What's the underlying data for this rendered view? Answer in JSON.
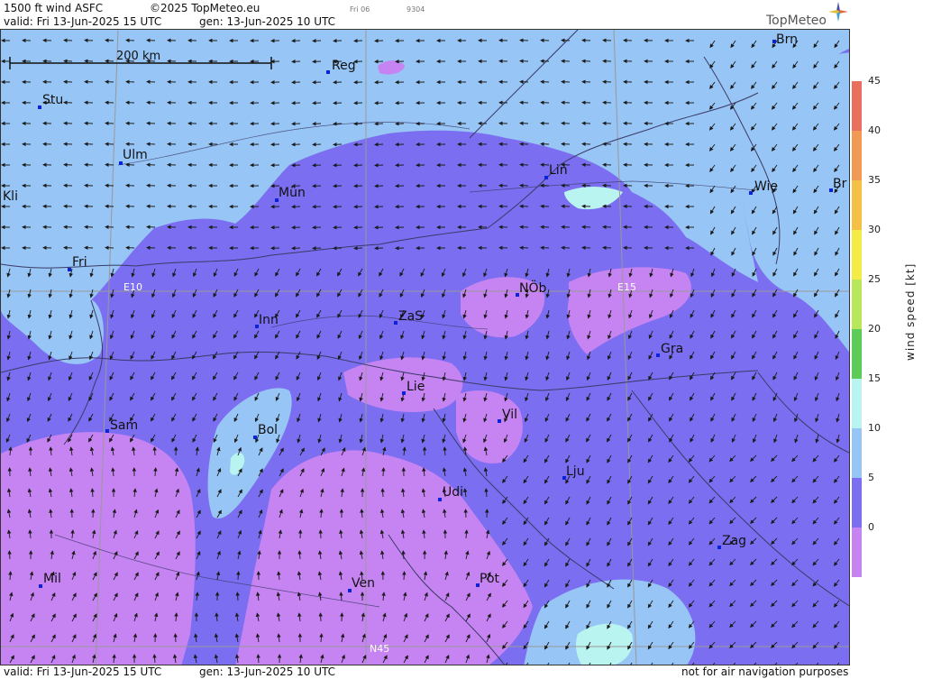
{
  "header": {
    "product": "1500 ft wind ASFC",
    "copyright": "©2025 TopMeteo.eu",
    "day_code": "Fri 06",
    "code": "9304",
    "valid": "valid:  Fri  13-Jun-2025  15 UTC",
    "generated": "gen: 13-Jun-2025 10 UTC",
    "logo_text": "TopMeteo"
  },
  "footer": {
    "valid": "valid:  Fri  13-Jun-2025  15 UTC",
    "generated": "gen: 13-Jun-2025 10 UTC",
    "disclaimer": "not for air navigation purposes"
  },
  "scale_bar": {
    "label": "200 km"
  },
  "grid_labels": {
    "lon_e10": "E10",
    "lon_e15": "E15",
    "lat_n45": "N45"
  },
  "cities": [
    {
      "name": "Brn"
    },
    {
      "name": "Reg"
    },
    {
      "name": "Stu"
    },
    {
      "name": "Ulm"
    },
    {
      "name": "Lin"
    },
    {
      "name": "Wie"
    },
    {
      "name": "Br"
    },
    {
      "name": "Mün"
    },
    {
      "name": "Kli"
    },
    {
      "name": "Fri"
    },
    {
      "name": "NÖb"
    },
    {
      "name": "Inn"
    },
    {
      "name": "ZaS"
    },
    {
      "name": "Gra"
    },
    {
      "name": "Lie"
    },
    {
      "name": "Sam"
    },
    {
      "name": "Bol"
    },
    {
      "name": "Vil"
    },
    {
      "name": "Lju"
    },
    {
      "name": "Udi"
    },
    {
      "name": "Zag"
    },
    {
      "name": "Mil"
    },
    {
      "name": "Ven"
    },
    {
      "name": "Pot"
    }
  ],
  "legend": {
    "title": "wind speed [kt]",
    "ticks": [
      "45",
      "40",
      "35",
      "30",
      "25",
      "20",
      "15",
      "10",
      "5",
      "0"
    ],
    "colors": [
      "#e96f5e",
      "#f19a55",
      "#f4c047",
      "#f4ec46",
      "#b8e85a",
      "#5ccb57",
      "#b9f4f0",
      "#97c5f5",
      "#7b6ef1",
      "#c683f2"
    ]
  },
  "map_colors": {
    "wind_0_5": "#c683f2",
    "wind_5_10": "#7b6ef1",
    "wind_10_15": "#97c5f5",
    "wind_15_20": "#b9f4f0",
    "borders": "#3a3a66",
    "grid": "#999999"
  }
}
